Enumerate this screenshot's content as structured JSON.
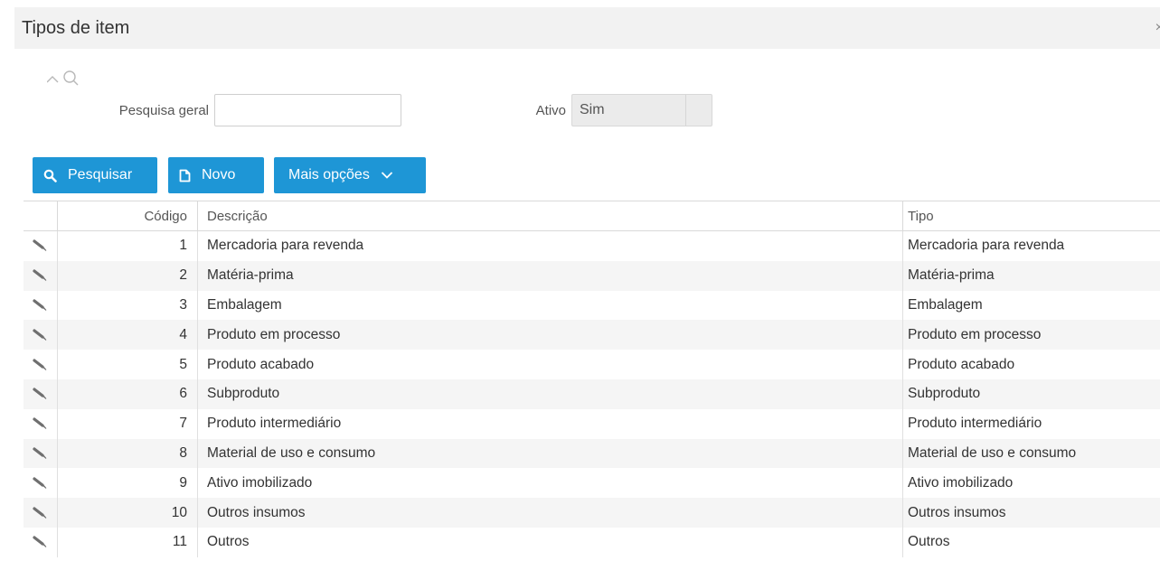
{
  "window": {
    "title": "Tipos de item",
    "close": "×"
  },
  "filters": {
    "search_label": "Pesquisa geral",
    "search_value": "",
    "ativo_label": "Ativo",
    "ativo_value": "Sim"
  },
  "toolbar": {
    "pesquisar_label": "Pesquisar",
    "novo_label": "Novo",
    "mais_label": "Mais opções"
  },
  "table": {
    "columns": {
      "edit": "",
      "codigo": "Código",
      "descricao": "Descrição",
      "tipo": "Tipo"
    },
    "rows": [
      {
        "codigo": "1",
        "descricao": "Mercadoria para revenda",
        "tipo": "Mercadoria para revenda"
      },
      {
        "codigo": "2",
        "descricao": "Matéria-prima",
        "tipo": "Matéria-prima"
      },
      {
        "codigo": "3",
        "descricao": "Embalagem",
        "tipo": "Embalagem"
      },
      {
        "codigo": "4",
        "descricao": "Produto em processo",
        "tipo": "Produto em processo"
      },
      {
        "codigo": "5",
        "descricao": "Produto acabado",
        "tipo": "Produto acabado"
      },
      {
        "codigo": "6",
        "descricao": "Subproduto",
        "tipo": "Subproduto"
      },
      {
        "codigo": "7",
        "descricao": "Produto intermediário",
        "tipo": "Produto intermediário"
      },
      {
        "codigo": "8",
        "descricao": "Material de uso e consumo",
        "tipo": "Material de uso e consumo"
      },
      {
        "codigo": "9",
        "descricao": "Ativo imobilizado",
        "tipo": "Ativo imobilizado"
      },
      {
        "codigo": "10",
        "descricao": "Outros insumos",
        "tipo": "Outros insumos"
      },
      {
        "codigo": "11",
        "descricao": "Outros",
        "tipo": "Outros"
      }
    ]
  },
  "icons": {
    "filter_toggle": "chevron-up-icon",
    "filter_search": "search-icon",
    "pesquisar": "search-icon",
    "novo": "new-document-icon",
    "mais": "chevron-down-icon",
    "row_edit": "pencil-icon"
  },
  "colors": {
    "primary": "#1e96d6",
    "titlebar": "#f2f2f2",
    "row_alt": "#f5f5f5"
  }
}
